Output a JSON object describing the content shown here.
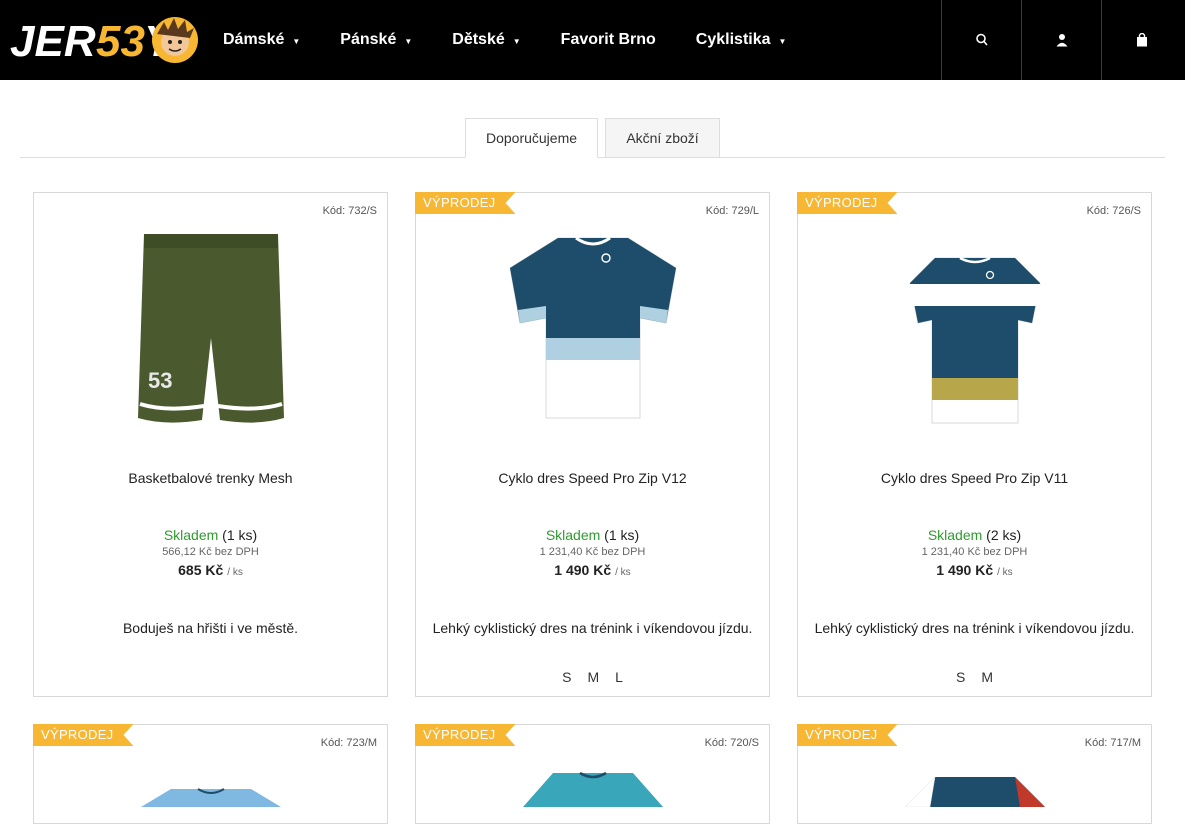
{
  "header": {
    "logo_text": "JER53Y",
    "nav": [
      {
        "label": "Dámské",
        "has_caret": true
      },
      {
        "label": "Pánské",
        "has_caret": true
      },
      {
        "label": "Dětské",
        "has_caret": true
      },
      {
        "label": "Favorit Brno",
        "has_caret": false
      },
      {
        "label": "Cyklistika",
        "has_caret": true
      }
    ],
    "icons": [
      "search-icon",
      "user-icon",
      "cart-icon"
    ]
  },
  "tabs": [
    {
      "label": "Doporučujeme",
      "active": true
    },
    {
      "label": "Akční zboží",
      "active": false
    }
  ],
  "products": [
    {
      "flag": "",
      "code": "Kód: 732/S",
      "name": "Basketbalové trenky Mesh",
      "stock_label": "Skladem",
      "stock_count": "(1 ks)",
      "price_net": "566,12 Kč bez DPH",
      "price": "685 Kč",
      "unit": "/ ks",
      "description": "Boduješ na hřišti i ve městě.",
      "sizes": []
    },
    {
      "flag": "VÝPRODEJ",
      "code": "Kód: 729/L",
      "name": "Cyklo dres Speed Pro Zip V12",
      "stock_label": "Skladem",
      "stock_count": "(1 ks)",
      "price_net": "1 231,40 Kč bez DPH",
      "price": "1 490 Kč",
      "unit": "/ ks",
      "description": "Lehký cyklistický dres na trénink i víkendovou jízdu.",
      "sizes": [
        "S",
        "M",
        "L"
      ]
    },
    {
      "flag": "VÝPRODEJ",
      "code": "Kód: 726/S",
      "name": "Cyklo dres Speed Pro Zip V11",
      "stock_label": "Skladem",
      "stock_count": "(2 ks)",
      "price_net": "1 231,40 Kč bez DPH",
      "price": "1 490 Kč",
      "unit": "/ ks",
      "description": "Lehký cyklistický dres na trénink i víkendovou jízdu.",
      "sizes": [
        "S",
        "M"
      ]
    },
    {
      "flag": "VÝPRODEJ",
      "code": "Kód: 723/M"
    },
    {
      "flag": "VÝPRODEJ",
      "code": "Kód: 720/S"
    },
    {
      "flag": "VÝPRODEJ",
      "code": "Kód: 717/M"
    }
  ],
  "colors": {
    "header_bg": "#000000",
    "flag": "#f7b733",
    "in_stock": "#2e9b2e"
  }
}
